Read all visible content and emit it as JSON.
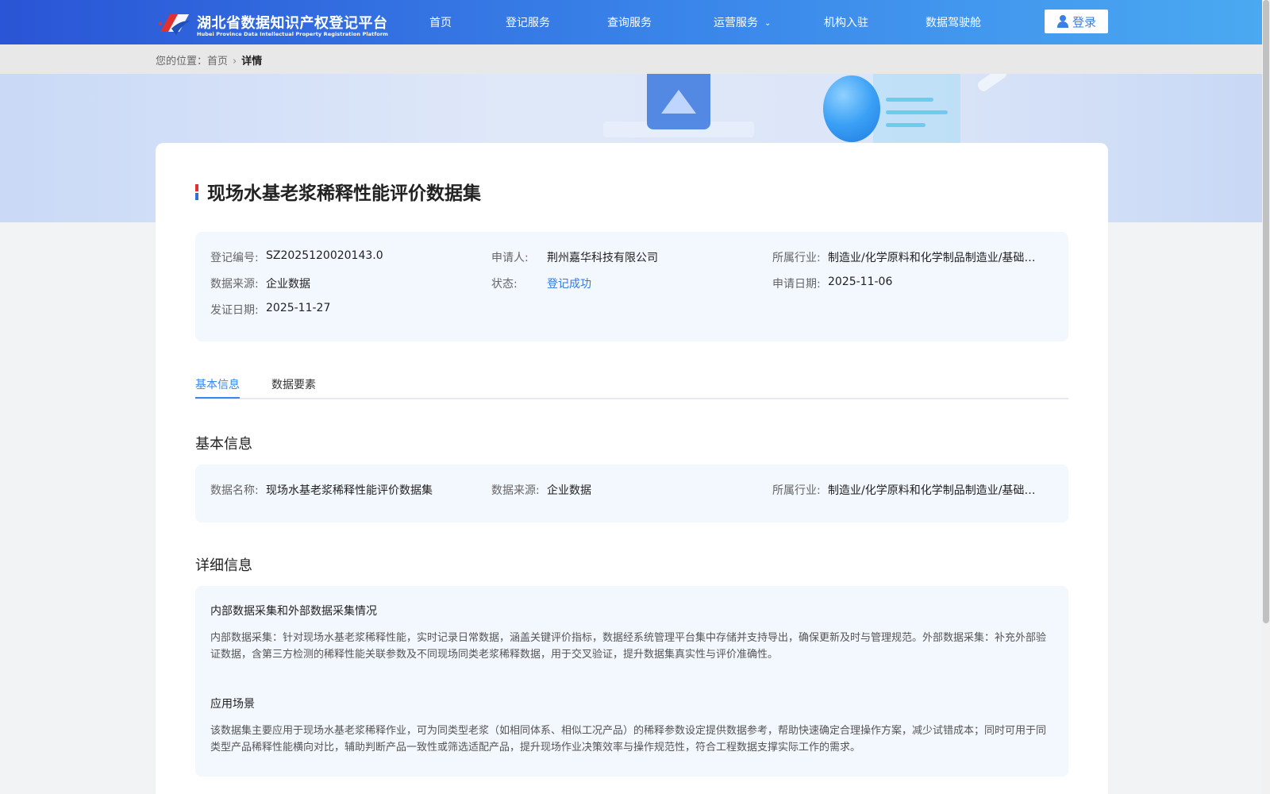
{
  "header": {
    "logo_cn": "湖北省数据知识产权登记平台",
    "logo_en": "Hubei Province Data Intellectual Property Registration Platform",
    "nav": [
      "首页",
      "登记服务",
      "查询服务",
      "运营服务",
      "机构入驻",
      "数据驾驶舱"
    ],
    "login_label": "登录"
  },
  "breadcrumb": {
    "prefix": "您的位置：",
    "home": "首页",
    "current": "详情"
  },
  "record": {
    "title": "现场水基老浆稀释性能评价数据集",
    "reg_no_label": "登记编号:",
    "reg_no": "SZ2025120020143.0",
    "applicant_label": "申请人:",
    "applicant": "荆州嘉华科技有限公司",
    "industry_label": "所属行业:",
    "industry": "制造业/化学原料和化学制品制造业/基础化学原料制造",
    "source_label": "数据来源:",
    "source": "企业数据",
    "status_label": "状态:",
    "status": "登记成功",
    "apply_date_label": "申请日期:",
    "apply_date": "2025-11-06",
    "issue_date_label": "发证日期:",
    "issue_date": "2025-11-27"
  },
  "tabs": [
    "基本信息",
    "数据要素"
  ],
  "basic": {
    "section_title": "基本信息",
    "name_label": "数据名称:",
    "name": "现场水基老浆稀释性能评价数据集",
    "source_label": "数据来源:",
    "source": "企业数据",
    "industry_label": "所属行业:",
    "industry": "制造业/化学原料和化学制品制造业/基础化学原料制造"
  },
  "detail": {
    "section_title": "详细信息",
    "collection_title": "内部数据采集和外部数据采集情况",
    "collection_text": "内部数据采集：针对现场水基老浆稀释性能，实时记录日常数据，涵盖关键评价指标，数据经系统管理平台集中存储并支持导出，确保更新及时与管理规范。外部数据采集：补充外部验证数据，含第三方检测的稀释性能关联参数及不同现场同类老浆稀释数据，用于交叉验证，提升数据集真实性与评价准确性。",
    "scenario_title": "应用场景",
    "scenario_text": "该数据集主要应用于现场水基老浆稀释作业，可为同类型老浆（如相同体系、相似工况产品）的稀释参数设定提供数据参考，帮助快速确定合理操作方案，减少试错成本；同时可用于同类型产品稀释性能横向对比，辅助判断产品一致性或筛选适配产品，提升现场作业决策效率与操作规范性，符合工程数据支撑实际工作的需求。"
  },
  "colors": {
    "header_start": "#2a55d6",
    "header_end": "#4aa9f1",
    "accent": "#3b86ea",
    "status": "#2f79e6",
    "panel": "#f3f7fe"
  }
}
